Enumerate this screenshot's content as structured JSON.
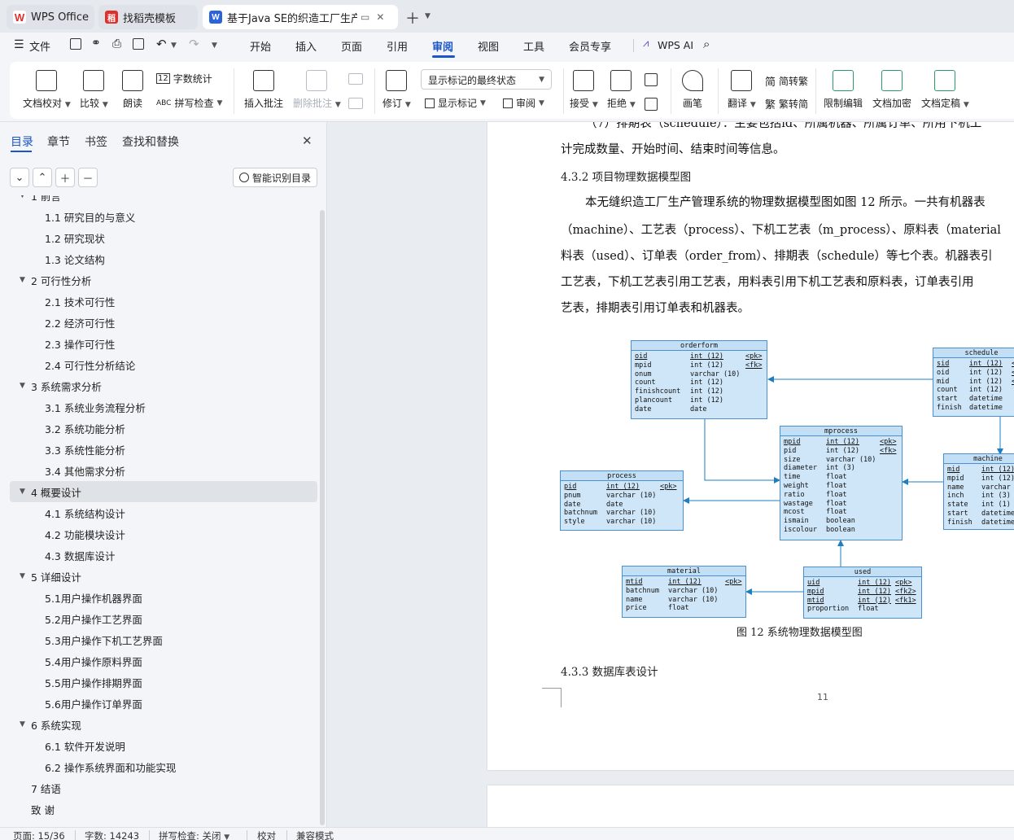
{
  "tabs": [
    {
      "label": "WPS Office",
      "icon": "wps-logo-icon"
    },
    {
      "label": "找稻壳模板",
      "icon": "docer-icon"
    },
    {
      "label": "基于Java SE的织造工厂生产管",
      "icon": "writer-doc-icon"
    }
  ],
  "menu": {
    "file": "文件",
    "items": [
      "开始",
      "插入",
      "页面",
      "引用",
      "审阅",
      "视图",
      "工具",
      "会员专享"
    ],
    "active": "审阅",
    "ai": "WPS AI"
  },
  "ribbon": {
    "proofread": "文档校对",
    "compare": "比较",
    "read_aloud": "朗读",
    "word_count": "字数统计",
    "spell_check": "拼写检查",
    "insert_comment": "插入批注",
    "delete_comment": "删除批注",
    "track": "修订",
    "markup_select": "显示标记的最终状态",
    "show_markup": "显示标记",
    "review": "审阅",
    "accept": "接受",
    "reject": "拒绝",
    "pen": "画笔",
    "translate": "翻译",
    "to_traditional": "简转繁",
    "to_simplified": "繁转简",
    "restrict": "限制编辑",
    "encrypt": "文档加密",
    "finalize": "文档定稿"
  },
  "nav": {
    "tabs": [
      "目录",
      "章节",
      "书签",
      "查找和替换"
    ],
    "smart_button": "智能识别目录",
    "outline": [
      {
        "level": 1,
        "text": "1  前言",
        "expanded": true
      },
      {
        "level": 2,
        "text": "1.1   研究目的与意义"
      },
      {
        "level": 2,
        "text": "1.2   研究现状"
      },
      {
        "level": 2,
        "text": "1.3   论文结构"
      },
      {
        "level": 1,
        "text": "2   可行性分析",
        "expanded": true
      },
      {
        "level": 2,
        "text": "2.1   技术可行性"
      },
      {
        "level": 2,
        "text": "2.2   经济可行性"
      },
      {
        "level": 2,
        "text": "2.3   操作可行性"
      },
      {
        "level": 2,
        "text": "2.4   可行性分析结论"
      },
      {
        "level": 1,
        "text": "3   系统需求分析",
        "expanded": true
      },
      {
        "level": 2,
        "text": "3.1   系统业务流程分析"
      },
      {
        "level": 2,
        "text": "3.2   系统功能分析"
      },
      {
        "level": 2,
        "text": "3.3   系统性能分析"
      },
      {
        "level": 2,
        "text": "3.4   其他需求分析"
      },
      {
        "level": 1,
        "text": "4   概要设计",
        "expanded": true,
        "selected": true
      },
      {
        "level": 2,
        "text": "4.1   系统结构设计"
      },
      {
        "level": 2,
        "text": "4.2   功能模块设计"
      },
      {
        "level": 2,
        "text": "4.3   数据库设计"
      },
      {
        "level": 1,
        "text": "5   详细设计",
        "expanded": true
      },
      {
        "level": 2,
        "text": "5.1用户操作机器界面"
      },
      {
        "level": 2,
        "text": "5.2用户操作工艺界面"
      },
      {
        "level": 2,
        "text": "5.3用户操作下机工艺界面"
      },
      {
        "level": 2,
        "text": "5.4用户操作原料界面"
      },
      {
        "level": 2,
        "text": "5.5用户操作排期界面"
      },
      {
        "level": 2,
        "text": "5.6用户操作订单界面"
      },
      {
        "level": 1,
        "text": "6   系统实现",
        "expanded": true
      },
      {
        "level": 2,
        "text": "6.1   软件开发说明"
      },
      {
        "level": 2,
        "text": "6.2   操作系统界面和功能实现"
      },
      {
        "level": 1,
        "text": "7   结语",
        "expanded": false
      },
      {
        "level": 1,
        "text": "致         谢",
        "expanded": false
      }
    ]
  },
  "doc": {
    "p1a": "（7）排期表（schedule）：主要包括id、所属机器、所属订单、所用下机工",
    "p1b": "计完成数量、开始时间、结束时间等信息。",
    "h432": "4.3.2     项目物理数据模型图",
    "p2a": "本无缝织造工厂生产管理系统的物理数据模型图如图 12 所示。一共有机器表",
    "p2b": "（machine）、工艺表（process）、下机工艺表（m_process）、原料表（material",
    "p2c": "料表（used）、订单表（order_from）、排期表（schedule）等七个表。机器表引",
    "p2d": "工艺表，下机工艺表引用工艺表，用料表引用下机工艺表和原料表，订单表引用",
    "p2e": "艺表，排期表引用订单表和机器表。",
    "caption": "图 12     系统物理数据模型图",
    "h433": "4.3.3     数据库表设计",
    "page_number": "11"
  },
  "er": {
    "orderform": {
      "title": "orderform",
      "rows": [
        [
          "oid",
          "int (12)",
          "<pk>"
        ],
        [
          "mpid",
          "int (12)",
          "<fk>"
        ],
        [
          "onum",
          "varchar (10)",
          ""
        ],
        [
          "count",
          "int (12)",
          ""
        ],
        [
          "finishcount",
          "int (12)",
          ""
        ],
        [
          "plancount",
          "int (12)",
          ""
        ],
        [
          "date",
          "date",
          ""
        ]
      ]
    },
    "schedule": {
      "title": "schedule",
      "rows": [
        [
          "sid",
          "int (12)",
          "<"
        ],
        [
          "oid",
          "int (12)",
          "<"
        ],
        [
          "mid",
          "int (12)",
          "<"
        ],
        [
          "count",
          "int (12)",
          ""
        ],
        [
          "start",
          "datetime",
          ""
        ],
        [
          "finish",
          "datetime",
          ""
        ]
      ]
    },
    "mprocess": {
      "title": "mprocess",
      "rows": [
        [
          "mpid",
          "int (12)",
          "<pk>"
        ],
        [
          "pid",
          "int (12)",
          "<fk>"
        ],
        [
          "size",
          "varchar (10)",
          ""
        ],
        [
          "diameter",
          "int (3)",
          ""
        ],
        [
          "time",
          "float",
          ""
        ],
        [
          "weight",
          "float",
          ""
        ],
        [
          "ratio",
          "float",
          ""
        ],
        [
          "wastage",
          "float",
          ""
        ],
        [
          "mcost",
          "float",
          ""
        ],
        [
          "ismain",
          "boolean",
          ""
        ],
        [
          "iscolour",
          "boolean",
          ""
        ]
      ]
    },
    "machine": {
      "title": "machine",
      "rows": [
        [
          "mid",
          "int (12)",
          ""
        ],
        [
          "mpid",
          "int (12)",
          ""
        ],
        [
          "name",
          "varchar (",
          ""
        ],
        [
          "inch",
          "int (3)",
          ""
        ],
        [
          "state",
          "int (1)",
          ""
        ],
        [
          "start",
          "datetime",
          ""
        ],
        [
          "finish",
          "datetime",
          ""
        ]
      ]
    },
    "process": {
      "title": "process",
      "rows": [
        [
          "pid",
          "int (12)",
          "<pk>"
        ],
        [
          "pnum",
          "varchar (10)",
          ""
        ],
        [
          "date",
          "date",
          ""
        ],
        [
          "batchnum",
          "varchar (10)",
          ""
        ],
        [
          "style",
          "varchar (10)",
          ""
        ]
      ]
    },
    "material": {
      "title": "material",
      "rows": [
        [
          "mtid",
          "int (12)",
          "<pk>"
        ],
        [
          "batchnum",
          "varchar (10)",
          ""
        ],
        [
          "name",
          "varchar (10)",
          ""
        ],
        [
          "price",
          "float",
          ""
        ]
      ]
    },
    "used": {
      "title": "used",
      "rows": [
        [
          "uid",
          "int (12)",
          "<pk>"
        ],
        [
          "mpid",
          "int (12)",
          "<fk2>"
        ],
        [
          "mtid",
          "int (12)",
          "<fk1>"
        ],
        [
          "proportion",
          "float",
          ""
        ]
      ]
    }
  },
  "status": {
    "page": "页面: 15/36",
    "words": "字数: 14243",
    "spell": "拼写检查: 关闭",
    "proof": "校对",
    "compat": "兼容模式"
  },
  "colors": {
    "accent": "#1a55c9",
    "er_fill": "#cfe6f8",
    "er_line": "#1c7fc0"
  }
}
